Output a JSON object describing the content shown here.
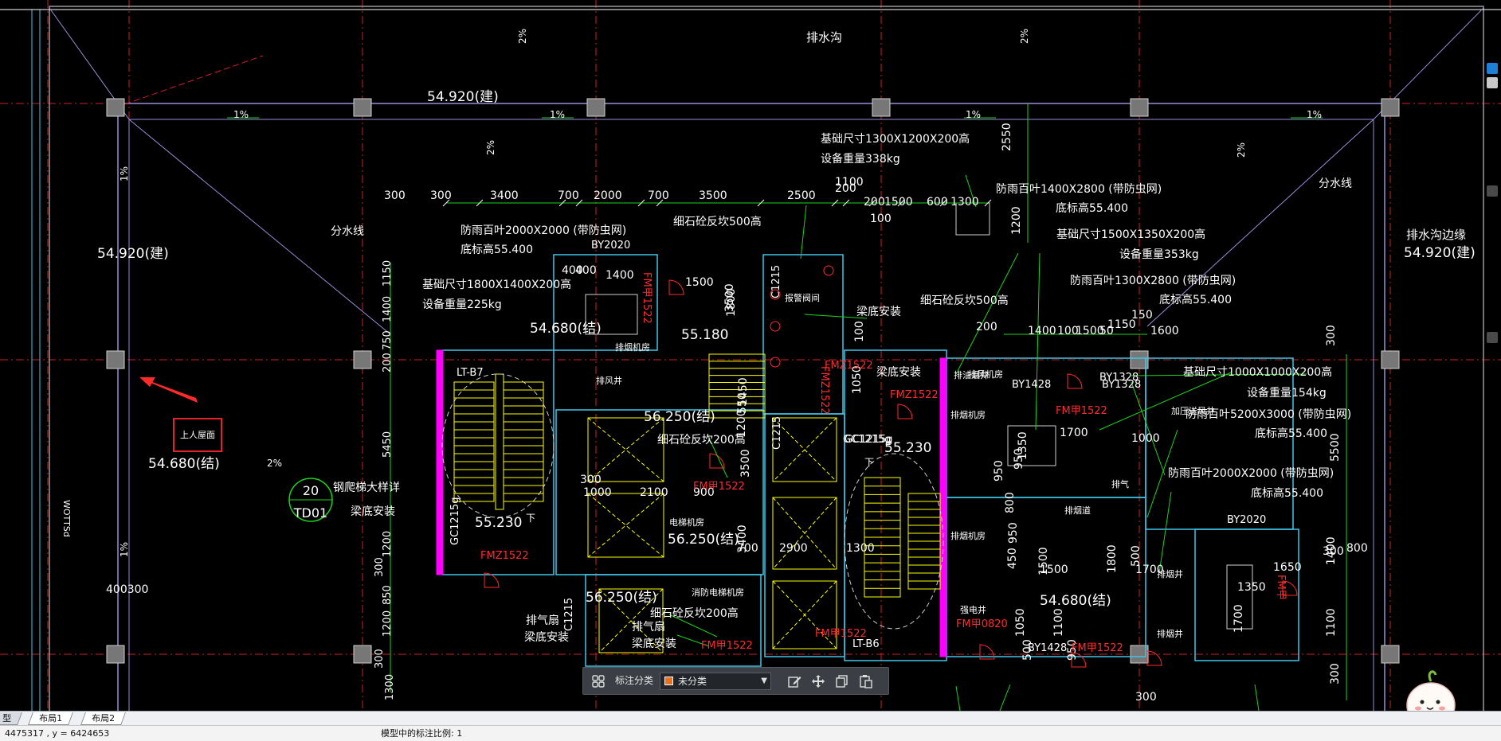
{
  "layout_tabs": [
    {
      "label": "型"
    },
    {
      "label": "布局1"
    },
    {
      "label": "布局2"
    }
  ],
  "status": {
    "coords": "4475317 , y = 6424653",
    "scale_text": "模型中的标注比例: 1"
  },
  "anno_toolbar": {
    "label": "标注分类",
    "selected": "未分类",
    "swatch_color": "#e8701e",
    "icons": [
      "grid-icon",
      "edit-icon",
      "move-icon",
      "copy-icon",
      "paste-icon"
    ]
  },
  "callout": {
    "label": "上人屋面"
  },
  "colors": {
    "cyan": "#3fc6e8",
    "green": "#19d619",
    "white": "#ffffff",
    "yellow": "#ffff00",
    "red": "#ff2a2a",
    "magenta": "#ff00ff",
    "purple": "#9a8cd9"
  },
  "drawing": {
    "top_labels": [
      "排水沟",
      "2%",
      "2%",
      "2%",
      "2%",
      "1%",
      "1%",
      "1%",
      "1%"
    ],
    "left_elev": "54.920(建)",
    "top_elev": "54.920(建)",
    "right_elev": "54.920(建)",
    "right_elev_label": "排水沟边缘",
    "left_roof_elev": "54.680(结)",
    "fenshuixian": "分水线",
    "dims_top": [
      "300",
      "3400",
      "700",
      "2000",
      "700",
      "3500",
      "2500",
      "200",
      "200",
      "1500",
      "600",
      "1300",
      "1100",
      "100"
    ],
    "dims_right_top": [
      "1400",
      "100",
      "1500",
      "50",
      "1150",
      "150",
      "1600",
      "200"
    ],
    "dims_right_col": [
      "300",
      "5500",
      "1400",
      "1100",
      "300"
    ],
    "dims_left_col": [
      "1150",
      "1400",
      "750",
      "200",
      "5450",
      "1200",
      "300",
      "850",
      "1200",
      "300",
      "1300"
    ],
    "dims_misc": [
      "400",
      "1400",
      "1500",
      "1800",
      "3500",
      "1450",
      "3500",
      "1200",
      "550",
      "1050",
      "100",
      "300",
      "1000",
      "2100",
      "900",
      "3400",
      "700",
      "2900",
      "1300",
      "1500",
      "1800",
      "450",
      "950",
      "1350",
      "1050",
      "500",
      "1700",
      "1000",
      "500",
      "1350",
      "1700",
      "1650",
      "300",
      "800",
      "400",
      "300",
      "950",
      "800",
      "950",
      "1500",
      "1700",
      "1100",
      "950",
      "300",
      "2550",
      "1200"
    ],
    "notes": [
      "基础尺寸1300X1200X200高",
      "设备重量338kg",
      "防雨百叶1400X2800 (带防虫网)",
      "底标高55.400",
      "防雨百叶2000X2000 (带防虫网)",
      "底标高55.400",
      "细石砼反坎500高",
      "基础尺寸1800X1400X200高",
      "设备重量225kg",
      "基础尺寸1500X1350X200高",
      "设备重量353kg",
      "防雨百叶1300X2800 (带防虫网)",
      "底标高55.400",
      "细石砼反坎500高",
      "梁底安装",
      "梁底安装",
      "基础尺寸1000X1000X200高",
      "设备重量154kg",
      "防雨百叶5200X3000 (带防虫网)",
      "底标高55.400",
      "防雨百叶2000X2000 (带防虫网)",
      "底标高55.400",
      "细石砼反坎200高",
      "细石砼反坎200高",
      "钢爬梯大样详",
      "梁底安装",
      "排气扇",
      "梁底安装",
      "排气扇",
      "梁底安装"
    ],
    "elevs": [
      "54.680(结)",
      "55.180",
      "56.250(结)",
      "55.230",
      "56.250(结)",
      "55.230",
      "56.250(结)",
      "54.680(结)"
    ],
    "room_labels": [
      "排烟机房",
      "排风井",
      "报警阀间",
      "电梯机房",
      "消防电梯机房",
      "排烟机房",
      "排风机房",
      "排油烟井",
      "排气",
      "排烟道",
      "排烟机房",
      "排烟井",
      "排烟井",
      "强电井",
      "加压送风井"
    ],
    "codes_white": [
      "LT-B7",
      "LT-B6",
      "BY2020",
      "BY1428",
      "BY1328",
      "BY2020",
      "BY1428",
      "C1215",
      "C1215",
      "C1215",
      "GC1215g",
      "GC1215g",
      "BY1328",
      "GC1215g"
    ],
    "codes_red": [
      "FM甲1522",
      "FMZ1522",
      "FM甲1522",
      "FM甲1522",
      "FMZ1522",
      "FMZ1522",
      "FM甲1522",
      "FM甲0820",
      "FM甲1522",
      "FM甲1522",
      "FMZ1522",
      "FM甲"
    ],
    "td_label": {
      "num": "20",
      "code": "TD01"
    },
    "bottom_left_dim": "400300",
    "misc_left": [
      "WOTTSd",
      "2%",
      "1%",
      "1%"
    ],
    "stair_down": [
      "下",
      "下"
    ]
  }
}
